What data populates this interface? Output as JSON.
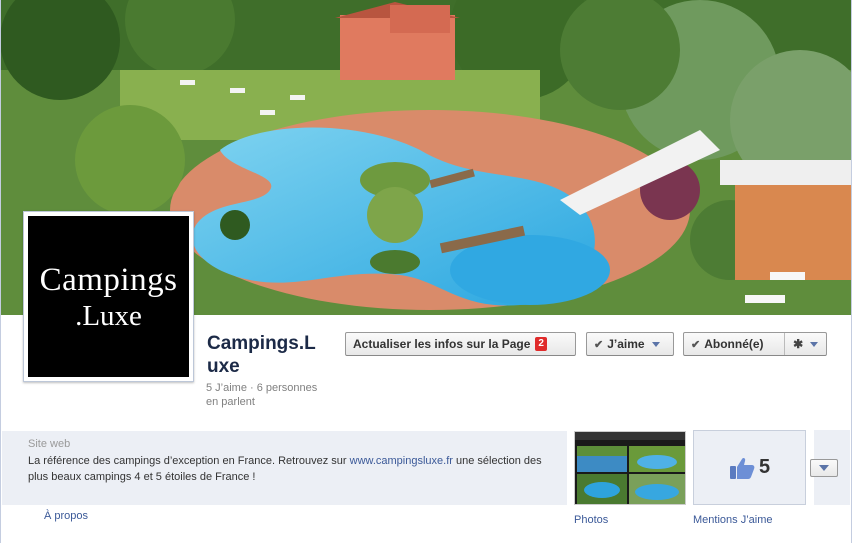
{
  "page": {
    "name": "Campings.Luxe",
    "name_line1": "Campings.L",
    "name_line2": "uxe",
    "meta_line1": "5 J’aime · 6 personnes",
    "meta_line2": "en parlent"
  },
  "profile": {
    "logo_line1": "Campings",
    "logo_line2": ".Luxe"
  },
  "buttons": {
    "update_label": "Actualiser les infos sur la Page",
    "update_badge": "2",
    "like_label": "J’aime",
    "subscribed_label": "Abonné(e)"
  },
  "about": {
    "label": "Site web",
    "text_before": "La référence des campings d’exception en France. Retrouvez sur ",
    "link": "www.campingsluxe.fr",
    "text_after": " une sélection des plus beaux campings 4 et 5 étoiles de France !",
    "apropos": "À propos"
  },
  "apps": {
    "photos_label": "Photos",
    "likes_count": "5",
    "likes_label": "Mentions J’aime"
  },
  "icons": [
    "check-icon",
    "dropdown-arrow-icon",
    "gear-icon",
    "thumbs-up-icon"
  ]
}
